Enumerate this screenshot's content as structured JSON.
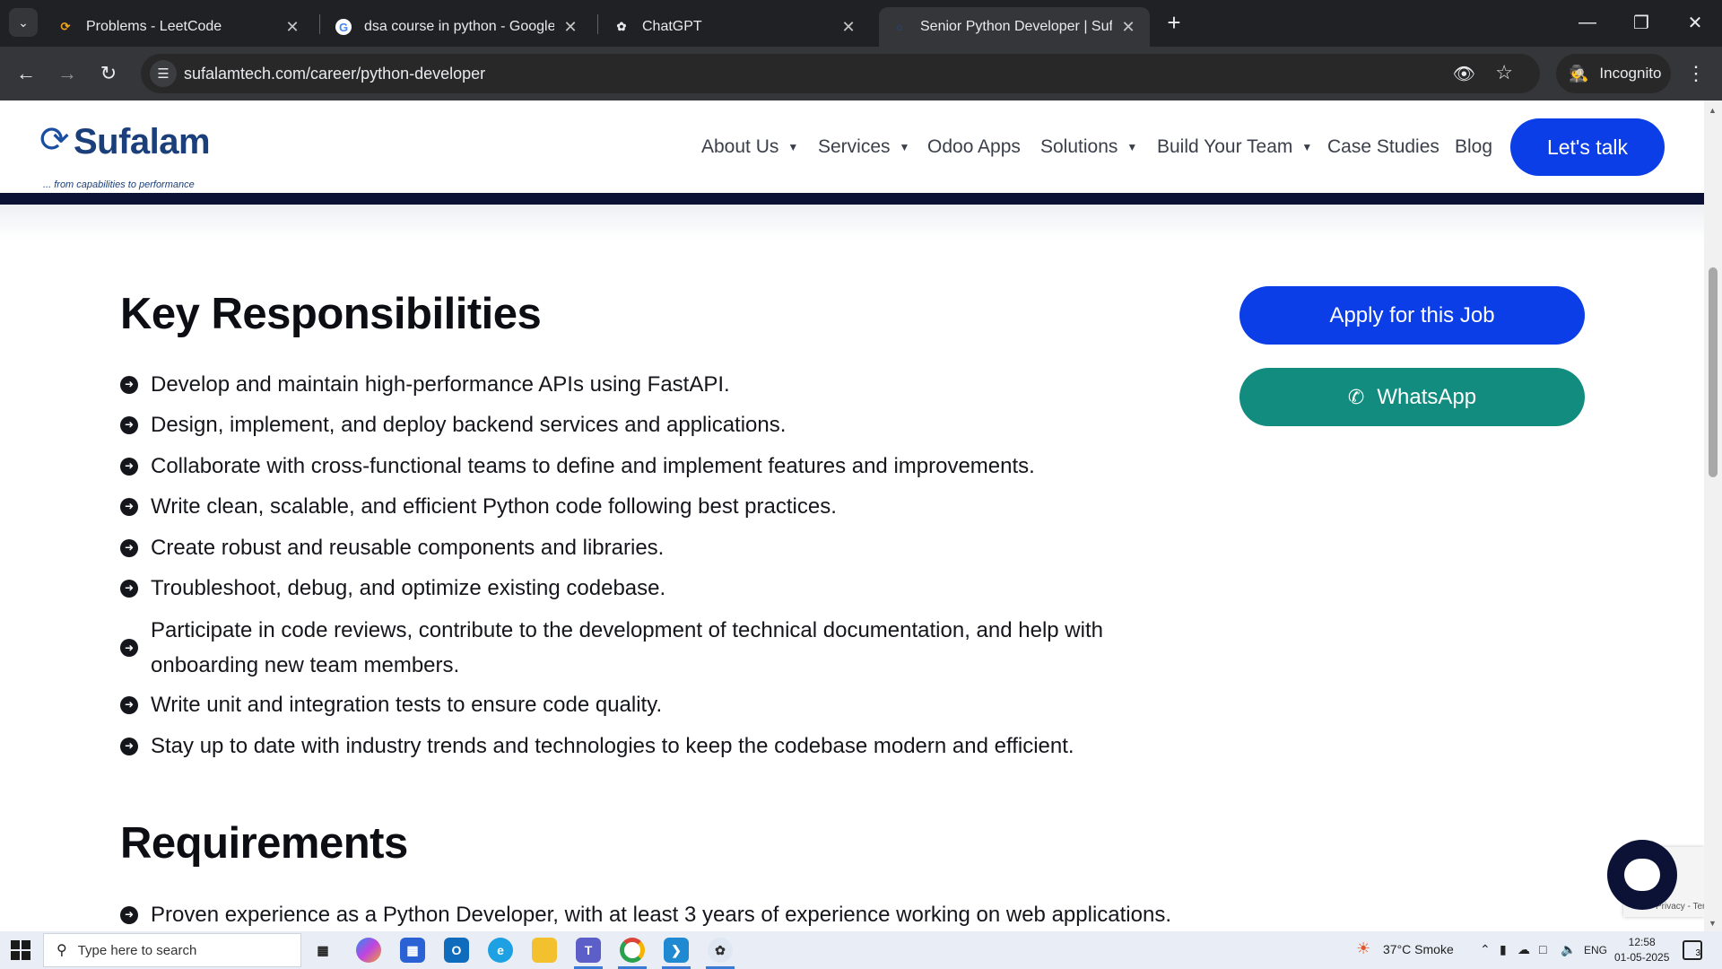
{
  "browser": {
    "tabs": [
      {
        "title": "Problems - LeetCode",
        "favicon": "leetcode-icon"
      },
      {
        "title": "dsa course in python - Google Search",
        "favicon": "google-icon"
      },
      {
        "title": "ChatGPT",
        "favicon": "chatgpt-icon"
      },
      {
        "title": "Senior Python Developer | Sufalam",
        "favicon": "sufalam-icon",
        "active": true
      }
    ],
    "url": "sufalamtech.com/career/python-developer",
    "incognito_label": "Incognito"
  },
  "site": {
    "logo_text": "Sufalam",
    "logo_tagline": "... from capabilities to performance",
    "nav": [
      {
        "label": "About Us",
        "has_dropdown": true
      },
      {
        "label": "Services",
        "has_dropdown": true
      },
      {
        "label": "Odoo Apps",
        "has_dropdown": false
      },
      {
        "label": "Solutions",
        "has_dropdown": true
      },
      {
        "label": "Build Your Team",
        "has_dropdown": true
      },
      {
        "label": "Case Studies",
        "has_dropdown": false
      },
      {
        "label": "Blog",
        "has_dropdown": false
      }
    ],
    "cta": "Let's talk",
    "colors": {
      "primary": "#0b3ee6",
      "whatsapp": "#128c7e",
      "dark": "#0b1236"
    }
  },
  "content": {
    "responsibilities_title": "Key Responsibilities",
    "responsibilities": [
      "Develop and maintain high-performance APIs using FastAPI.",
      "Design, implement, and deploy backend services and applications.",
      "Collaborate with cross-functional teams to define and implement features and improvements.",
      "Write clean, scalable, and efficient Python code following best practices.",
      "Create robust and reusable components and libraries.",
      "Troubleshoot, debug, and optimize existing codebase.",
      "Participate in code reviews, contribute to the development of technical documentation, and help with onboarding new team members.",
      "Write unit and integration tests to ensure code quality.",
      "Stay up to date with industry trends and technologies to keep the codebase modern and efficient."
    ],
    "requirements_title": "Requirements",
    "requirements": [
      "Proven experience as a Python Developer, with at least 3 years of experience working on web applications."
    ],
    "apply_label": "Apply for this Job",
    "whatsapp_label": "WhatsApp",
    "recaptcha_terms": "Privacy - Terms"
  },
  "taskbar": {
    "search_placeholder": "Type here to search",
    "weather": "37°C  Smoke",
    "language": "ENG",
    "time": "12:58",
    "date": "01-05-2025",
    "notification_count": "3"
  }
}
